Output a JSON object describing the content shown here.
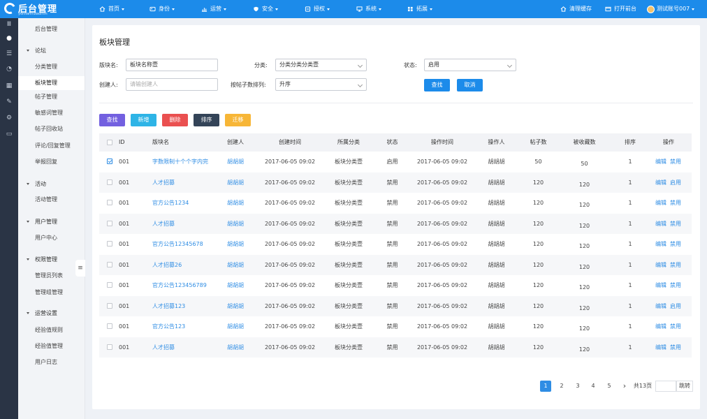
{
  "brand": {
    "title": "后台管理",
    "subtitle": "yunlianhuiadmin"
  },
  "topnav": {
    "items": [
      {
        "label": "首页",
        "icon": "home-icon"
      },
      {
        "label": "身份",
        "icon": "id-icon"
      },
      {
        "label": "运营",
        "icon": "chart-icon"
      },
      {
        "label": "安全",
        "icon": "shield-icon"
      },
      {
        "label": "授权",
        "icon": "key-icon"
      },
      {
        "label": "系统",
        "icon": "system-icon"
      },
      {
        "label": "拓展",
        "icon": "puzzle-icon"
      }
    ],
    "clear_cache": "清理缓存",
    "open_front": "打开前台",
    "account": "测试账号007"
  },
  "sidebar": {
    "top_item": "后台管理",
    "groups": [
      {
        "label": "论坛",
        "items": [
          "分类管理",
          "板块管理",
          "帖子管理",
          "敏感词管理",
          "帖子回收站",
          "评论/回复管理",
          "举报回复"
        ]
      },
      {
        "label": "活动",
        "items": [
          "活动管理"
        ]
      },
      {
        "label": "用户管理",
        "items": [
          "用户中心"
        ]
      },
      {
        "label": "权限管理",
        "items": [
          "管理员列表",
          "管理组管理"
        ]
      },
      {
        "label": "运营设置",
        "items": [
          "经验值规则",
          "经验值管理",
          "用户日志"
        ]
      }
    ],
    "active": "板块管理"
  },
  "page": {
    "title": "板块管理"
  },
  "filters": {
    "name_label": "版块名:",
    "name_value": "板块名称壹",
    "category_label": "分类:",
    "category_value": "分类分类分类壹",
    "status_label": "状态:",
    "status_value": "启用",
    "creator_label": "创建人:",
    "creator_placeholder": "请输创建人",
    "sort_label": "按帖子数排列:",
    "sort_value": "升序",
    "search_btn": "查找",
    "cancel_btn": "取消"
  },
  "actions": {
    "find": "查找",
    "add": "新增",
    "delete": "删除",
    "sort": "排序",
    "migrate": "迁移",
    "colors": {
      "find": "#7360e0",
      "add": "#2eb4e6",
      "delete": "#ea5050",
      "sort": "#344458",
      "migrate": "#f7b637"
    }
  },
  "table": {
    "columns": [
      "ID",
      "版块名",
      "创建人",
      "创建时间",
      "所属分类",
      "状态",
      "操作时间",
      "操作人",
      "帖子数",
      "被收藏数",
      "排序",
      "操作"
    ],
    "rows": [
      {
        "checked": true,
        "id": "001",
        "name": "字数限制十个个字内完",
        "creator": "胡胡胡",
        "created": "2017-06-05  09:02",
        "category": "板块分类壹",
        "status": "启用",
        "op_time": "2017-06-05  09:02",
        "operator": "胡胡胡",
        "posts": "50",
        "favs": "50",
        "order": "1",
        "edit": "编辑",
        "toggle": "禁用"
      },
      {
        "checked": false,
        "id": "001",
        "name": "人才招募",
        "creator": "胡胡胡",
        "created": "2017-06-05  09:02",
        "category": "板块分类壹",
        "status": "禁用",
        "op_time": "2017-06-05  09:02",
        "operator": "胡胡胡",
        "posts": "120",
        "favs": "120",
        "order": "1",
        "edit": "编辑",
        "toggle": "启用"
      },
      {
        "checked": false,
        "id": "001",
        "name": "官方公告1234",
        "creator": "胡胡胡",
        "created": "2017-06-05  09:02",
        "category": "板块分类壹",
        "status": "禁用",
        "op_time": "2017-06-05  09:02",
        "operator": "胡胡胡",
        "posts": "120",
        "favs": "120",
        "order": "1",
        "edit": "编辑",
        "toggle": "禁用"
      },
      {
        "checked": false,
        "id": "001",
        "name": "人才招募",
        "creator": "胡胡胡",
        "created": "2017-06-05  09:02",
        "category": "板块分类壹",
        "status": "禁用",
        "op_time": "2017-06-05  09:02",
        "operator": "胡胡胡",
        "posts": "120",
        "favs": "120",
        "order": "1",
        "edit": "编辑",
        "toggle": "禁用"
      },
      {
        "checked": false,
        "id": "001",
        "name": "官方公告12345678",
        "creator": "胡胡胡",
        "created": "2017-06-05  09:02",
        "category": "板块分类壹",
        "status": "禁用",
        "op_time": "2017-06-05  09:02",
        "operator": "胡胡胡",
        "posts": "120",
        "favs": "120",
        "order": "1",
        "edit": "编辑",
        "toggle": "禁用"
      },
      {
        "checked": false,
        "id": "001",
        "name": "人才招募26",
        "creator": "胡胡胡",
        "created": "2017-06-05  09:02",
        "category": "板块分类壹",
        "status": "禁用",
        "op_time": "2017-06-05  09:02",
        "operator": "胡胡胡",
        "posts": "120",
        "favs": "120",
        "order": "1",
        "edit": "编辑",
        "toggle": "禁用"
      },
      {
        "checked": false,
        "id": "001",
        "name": "官方公告123456789",
        "creator": "胡胡胡",
        "created": "2017-06-05  09:02",
        "category": "板块分类壹",
        "status": "禁用",
        "op_time": "2017-06-05  09:02",
        "operator": "胡胡胡",
        "posts": "120",
        "favs": "120",
        "order": "1",
        "edit": "编辑",
        "toggle": "禁用"
      },
      {
        "checked": false,
        "id": "001",
        "name": "人才招募123",
        "creator": "胡胡胡",
        "created": "2017-06-05  09:02",
        "category": "板块分类壹",
        "status": "禁用",
        "op_time": "2017-06-05  09:02",
        "operator": "胡胡胡",
        "posts": "120",
        "favs": "120",
        "order": "1",
        "edit": "编辑",
        "toggle": "启用"
      },
      {
        "checked": false,
        "id": "001",
        "name": "官方公告123",
        "creator": "胡胡胡",
        "created": "2017-06-05  09:02",
        "category": "板块分类壹",
        "status": "禁用",
        "op_time": "2017-06-05  09:02",
        "operator": "胡胡胡",
        "posts": "120",
        "favs": "120",
        "order": "1",
        "edit": "编辑",
        "toggle": "禁用"
      },
      {
        "checked": false,
        "id": "001",
        "name": "人才招募",
        "creator": "胡胡胡",
        "created": "2017-06-05  09:02",
        "category": "板块分类壹",
        "status": "禁用",
        "op_time": "2017-06-05  09:02",
        "operator": "胡胡胡",
        "posts": "120",
        "favs": "120",
        "order": "1",
        "edit": "编辑",
        "toggle": "禁用"
      }
    ]
  },
  "pagination": {
    "pages": [
      "1",
      "2",
      "3",
      "4",
      "5"
    ],
    "current": "1",
    "next": "›",
    "total": "共13页",
    "jump": "跳转"
  }
}
